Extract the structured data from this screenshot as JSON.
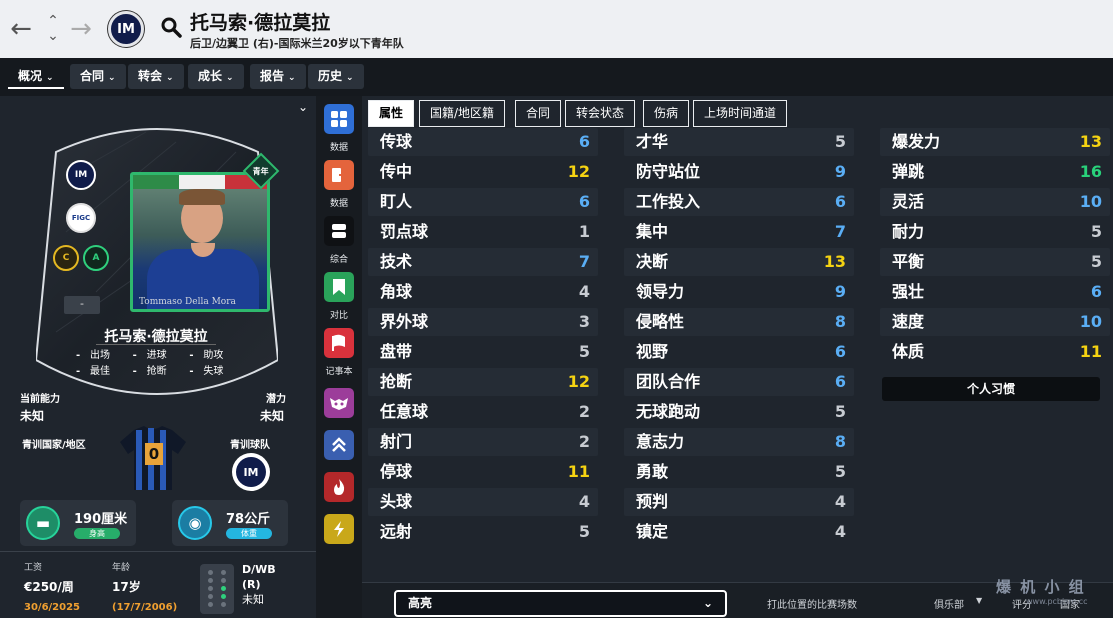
{
  "header": {
    "back_icon": "arrow-left-icon",
    "updown_icon": "up-down-chevron-icon",
    "forward_icon": "arrow-right-icon",
    "club_badge": "IM",
    "search_icon": "search-icon",
    "player_name": "托马索·德拉莫拉",
    "subtitle": "后卫/边翼卫 (右)-国际米兰20岁以下青年队"
  },
  "tabs": [
    {
      "label": "概况"
    },
    {
      "label": "合同"
    },
    {
      "label": "转会"
    },
    {
      "label": "成长"
    },
    {
      "label": "报告"
    },
    {
      "label": "历史"
    }
  ],
  "card": {
    "club_badge": "IM",
    "nation_badge": "FIGC",
    "trait_badge_1": "C",
    "trait_badge_2": "A",
    "dash": "-",
    "youth_label": "青年",
    "photo_caption": "Tommaso Della Mora",
    "name": "托马索·德拉莫拉",
    "stats": [
      {
        "value": "-",
        "label": "出场"
      },
      {
        "value": "-",
        "label": "进球"
      },
      {
        "value": "-",
        "label": "助攻"
      },
      {
        "value": "-",
        "label": "最佳"
      },
      {
        "value": "-",
        "label": "抢断"
      },
      {
        "value": "-",
        "label": "失球"
      }
    ]
  },
  "left": {
    "current_ability_label": "当前能力",
    "current_ability_value": "未知",
    "potential_label": "潜力",
    "potential_value": "未知",
    "youth_nation_label": "青训国家/地区",
    "youth_club_label": "青训球队",
    "shirt_number": "0",
    "youth_club_badge": "IM",
    "height_value": "190厘米",
    "height_label": "身高",
    "weight_value": "78公斤",
    "weight_label": "体重",
    "wage_label": "工资",
    "wage_value": "€250/周",
    "contract_end": "30/6/2025",
    "age_label": "年龄",
    "age_value": "17岁",
    "dob": "(17/7/2006)",
    "position_value": "D/WB",
    "position_side": "(R)",
    "position_unknown": "未知"
  },
  "sidebar_icons": [
    {
      "icon": "grid-icon",
      "label": "数据",
      "color": "#2f6fd6"
    },
    {
      "icon": "exit-icon",
      "label": "数据",
      "color": "#e4643c"
    },
    {
      "icon": "stack-icon",
      "label": "综合",
      "color": "#0f1114"
    },
    {
      "icon": "bookmark-icon",
      "label": "对比",
      "color": "#2aa35a"
    },
    {
      "icon": "flag-icon",
      "label": "记事本",
      "color": "#d9323c"
    },
    {
      "icon": "mask-icon",
      "label": "",
      "color": "#9c3d9a"
    },
    {
      "icon": "chevrons-up-icon",
      "label": "",
      "color": "#3a5fb0"
    },
    {
      "icon": "flame-icon",
      "label": "",
      "color": "#b4282a"
    },
    {
      "icon": "bolt-icon",
      "label": "",
      "color": "#c9a81a"
    }
  ],
  "subtabs": [
    {
      "label": "属性"
    },
    {
      "label": "国籍/地区籍"
    },
    {
      "label": "合同"
    },
    {
      "label": "转会状态"
    },
    {
      "label": "伤病"
    },
    {
      "label": "上场时间通道"
    }
  ],
  "attributes": {
    "col1": [
      {
        "name": "传球",
        "value": "6"
      },
      {
        "name": "传中",
        "value": "12"
      },
      {
        "name": "盯人",
        "value": "6"
      },
      {
        "name": "罚点球",
        "value": "1"
      },
      {
        "name": "技术",
        "value": "7"
      },
      {
        "name": "角球",
        "value": "4"
      },
      {
        "name": "界外球",
        "value": "3"
      },
      {
        "name": "盘带",
        "value": "5"
      },
      {
        "name": "抢断",
        "value": "12"
      },
      {
        "name": "任意球",
        "value": "2"
      },
      {
        "name": "射门",
        "value": "2"
      },
      {
        "name": "停球",
        "value": "11"
      },
      {
        "name": "头球",
        "value": "4"
      },
      {
        "name": "远射",
        "value": "5"
      }
    ],
    "col2": [
      {
        "name": "才华",
        "value": "5"
      },
      {
        "name": "防守站位",
        "value": "9"
      },
      {
        "name": "工作投入",
        "value": "6"
      },
      {
        "name": "集中",
        "value": "7"
      },
      {
        "name": "决断",
        "value": "13"
      },
      {
        "name": "领导力",
        "value": "9"
      },
      {
        "name": "侵略性",
        "value": "8"
      },
      {
        "name": "视野",
        "value": "6"
      },
      {
        "name": "团队合作",
        "value": "6"
      },
      {
        "name": "无球跑动",
        "value": "5"
      },
      {
        "name": "意志力",
        "value": "8"
      },
      {
        "name": "勇敢",
        "value": "5"
      },
      {
        "name": "预判",
        "value": "4"
      },
      {
        "name": "镇定",
        "value": "4"
      }
    ],
    "col3": [
      {
        "name": "爆发力",
        "value": "13"
      },
      {
        "name": "弹跳",
        "value": "16"
      },
      {
        "name": "灵活",
        "value": "10"
      },
      {
        "name": "耐力",
        "value": "5"
      },
      {
        "name": "平衡",
        "value": "5"
      },
      {
        "name": "强壮",
        "value": "6"
      },
      {
        "name": "速度",
        "value": "10"
      },
      {
        "name": "体质",
        "value": "11"
      }
    ],
    "habits_button": "个人习惯"
  },
  "bottom": {
    "highlight_label": "高亮",
    "matches_label": "打此位置的比赛场数",
    "club_label": "俱乐部",
    "rating_label": "评分",
    "intl_label": "国家"
  },
  "watermark": {
    "text": "爆 机 小 组",
    "url": "www.pcbjsm.cc"
  },
  "colors": {
    "value_white": "#c8ccd2",
    "value_blue": "#5aaef5",
    "value_yellow": "#f5d312",
    "value_green": "#29d17a"
  }
}
